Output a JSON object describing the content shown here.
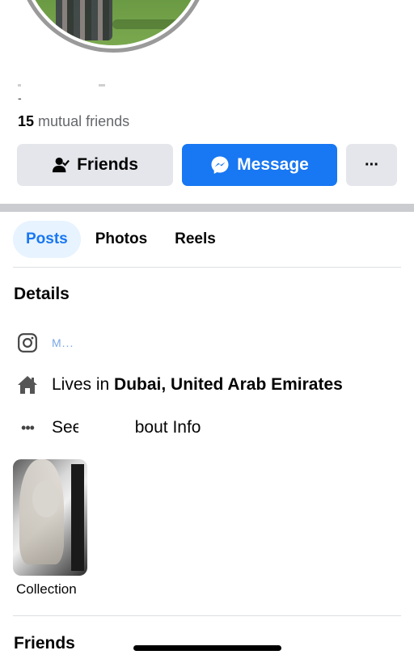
{
  "profile": {
    "name_line": "-",
    "mutual_count": "15",
    "mutual_label": "mutual friends"
  },
  "actions": {
    "friends_label": "Friends",
    "message_label": "Message",
    "more_label": "···"
  },
  "tabs": [
    {
      "label": "Posts",
      "active": true
    },
    {
      "label": "Photos",
      "active": false
    },
    {
      "label": "Reels",
      "active": false
    }
  ],
  "details": {
    "title": "Details",
    "instagram_text": "M...",
    "lives_prefix": "Lives in ",
    "lives_place": "Dubai, United Arab Emirates",
    "see_about": "See your About Info"
  },
  "featured": {
    "collection_label": "Collection"
  },
  "friends_section": {
    "title": "Friends"
  },
  "icons": [
    "user-check-icon",
    "messenger-icon",
    "more-icon",
    "instagram-icon",
    "home-icon",
    "ellipsis-icon"
  ],
  "colors": {
    "accent": "#1877f2",
    "tab_active_bg": "#e7f3ff",
    "button_gray": "#e4e6eb",
    "muted_text": "#65676b"
  }
}
